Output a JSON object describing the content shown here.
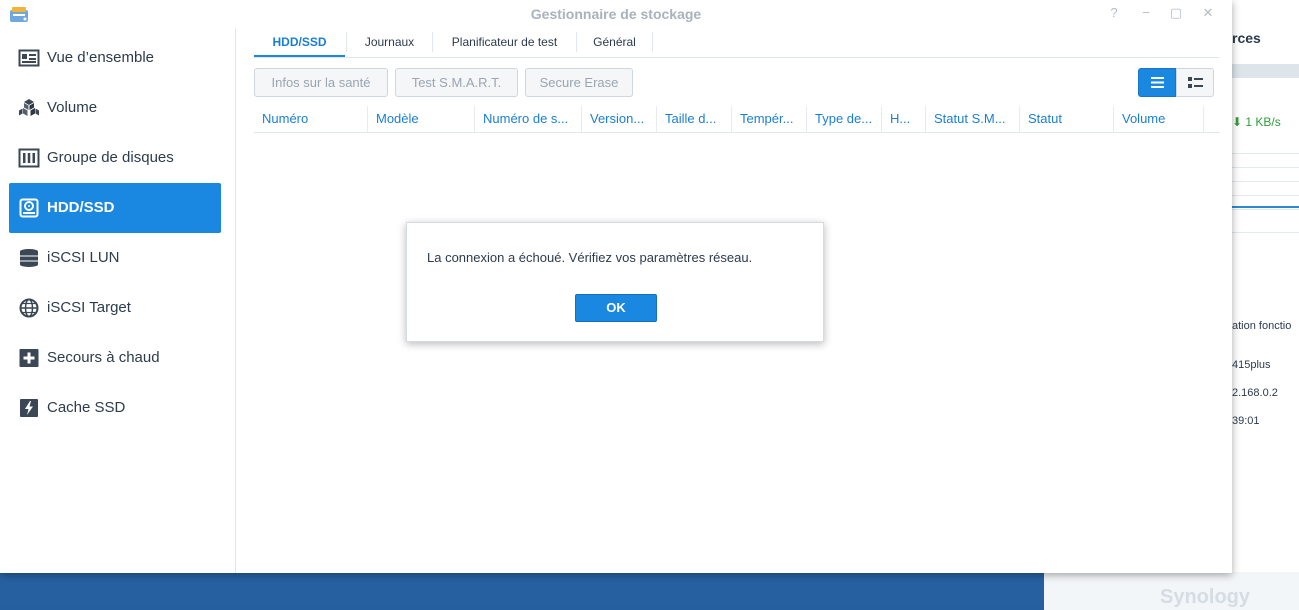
{
  "window": {
    "title": "Gestionnaire de stockage"
  },
  "sidebar": {
    "items": [
      {
        "label": "Vue d’ensemble",
        "icon": "overview-icon",
        "active": false
      },
      {
        "label": "Volume",
        "icon": "volume-cubes-icon",
        "active": false
      },
      {
        "label": "Groupe de disques",
        "icon": "disk-group-icon",
        "active": false
      },
      {
        "label": "HDD/SSD",
        "icon": "hdd-icon",
        "active": true
      },
      {
        "label": "iSCSI LUN",
        "icon": "database-stack-icon",
        "active": false
      },
      {
        "label": "iSCSI Target",
        "icon": "globe-icon",
        "active": false
      },
      {
        "label": "Secours à chaud",
        "icon": "plus-box-icon",
        "active": false
      },
      {
        "label": "Cache SSD",
        "icon": "lightning-drive-icon",
        "active": false
      }
    ]
  },
  "tabs": [
    {
      "label": "HDD/SSD",
      "active": true
    },
    {
      "label": "Journaux",
      "active": false
    },
    {
      "label": "Planificateur de test",
      "active": false
    },
    {
      "label": "Général",
      "active": false
    }
  ],
  "toolbar": {
    "health_label": "Infos sur la santé",
    "smart_label": "Test S.M.A.R.T.",
    "erase_label": "Secure Erase"
  },
  "grid": {
    "columns": [
      "Numéro",
      "Modèle",
      "Numéro de s...",
      "Version...",
      "Taille d...",
      "Tempér...",
      "Type de...",
      "H...",
      "Statut S.M...",
      "Statut",
      "Volume"
    ]
  },
  "dialog": {
    "message": "La connexion a échoué. Vérifiez vos paramètres réseau.",
    "ok_label": "OK"
  },
  "background_widget": {
    "title": "rces",
    "speed": "1 KB/s",
    "line1": "ation fonctio",
    "line2": "415plus",
    "line3": "2.168.0.2",
    "line4": "39:01",
    "brand": "Synology"
  },
  "colors": {
    "accent": "#1a87e0",
    "desktop": "#3f7fc4"
  }
}
